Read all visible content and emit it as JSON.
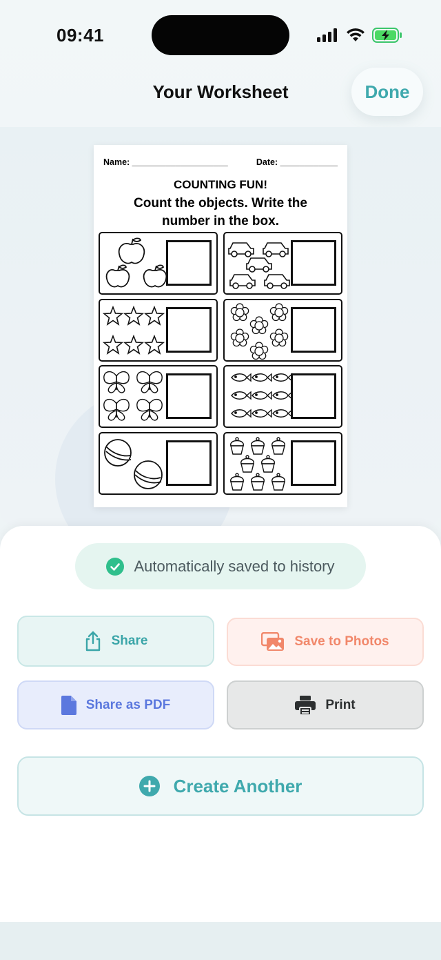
{
  "status_bar": {
    "time": "09:41",
    "icons": [
      "signal-icon",
      "wifi-icon",
      "battery-charging-icon"
    ]
  },
  "header": {
    "title": "Your Worksheet",
    "done_label": "Done"
  },
  "worksheet": {
    "name_label": "Name: ____________________",
    "date_label": "Date: ____________",
    "title": "COUNTING FUN!",
    "instruction_line1": "Count the objects. Write the",
    "instruction_line2": "number in the box.",
    "cells": [
      "apples",
      "cars",
      "stars",
      "flowers",
      "butterflies",
      "fish",
      "balls",
      "cupcakes"
    ]
  },
  "saved_notice": {
    "label": "Automatically saved to history",
    "icon": "check-circle-icon",
    "color": "#2fbf8c"
  },
  "actions": {
    "share": {
      "label": "Share",
      "icon": "share-icon",
      "color": "#3aa5a8"
    },
    "save_photos": {
      "label": "Save to Photos",
      "icon": "photos-icon",
      "color": "#f1876a"
    },
    "share_pdf": {
      "label": "Share as PDF",
      "icon": "document-icon",
      "color": "#5b78de"
    },
    "print": {
      "label": "Print",
      "icon": "printer-icon",
      "color": "#2c2f30"
    }
  },
  "create_another": {
    "label": "Create Another",
    "icon": "plus-circle-icon",
    "color": "#3fa9ad"
  }
}
